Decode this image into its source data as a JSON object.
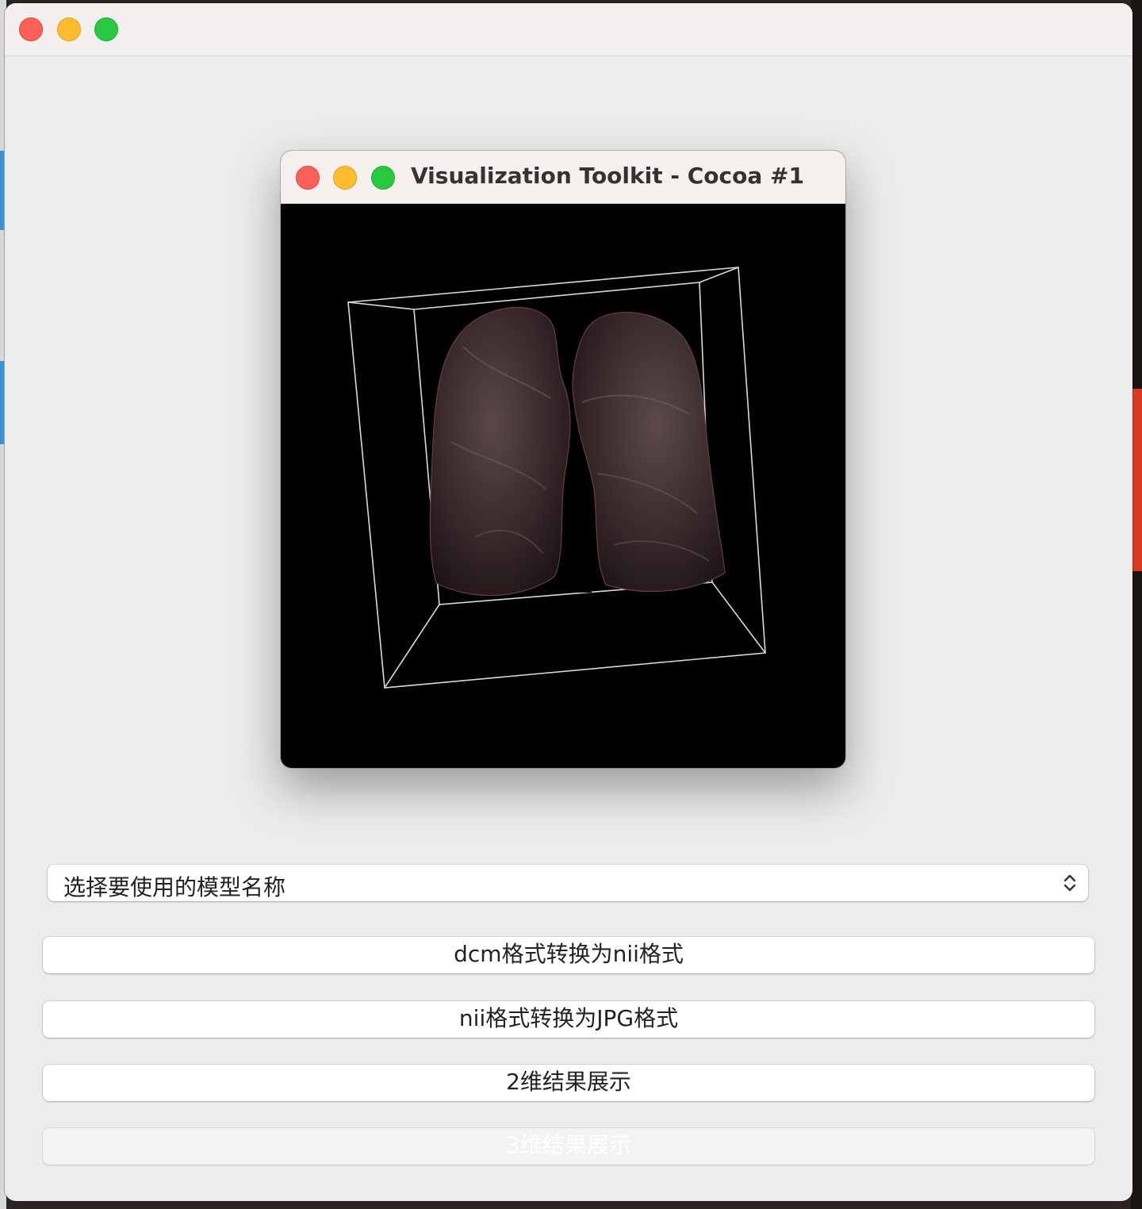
{
  "main_window": {
    "traffic_lights": [
      "close",
      "minimize",
      "maximize"
    ]
  },
  "vtk_window": {
    "title": "Visualization Toolkit - Cocoa #1",
    "render_background": "#000000",
    "render_subject": "3D lung volume rendering inside a bounding box outline"
  },
  "model_select": {
    "value": "选择要使用的模型名称",
    "icon": "up-down-chevron-icon"
  },
  "buttons": {
    "dcm_to_nii": "dcm格式转换为nii格式",
    "nii_to_jpg": "nii格式转换为JPG格式",
    "show_2d": "2维结果展示",
    "show_3d": "3维结果展示"
  },
  "colors": {
    "window_bg": "#ececec",
    "close": "#fe5f57",
    "minimize": "#febc2e",
    "maximize": "#28c840"
  }
}
